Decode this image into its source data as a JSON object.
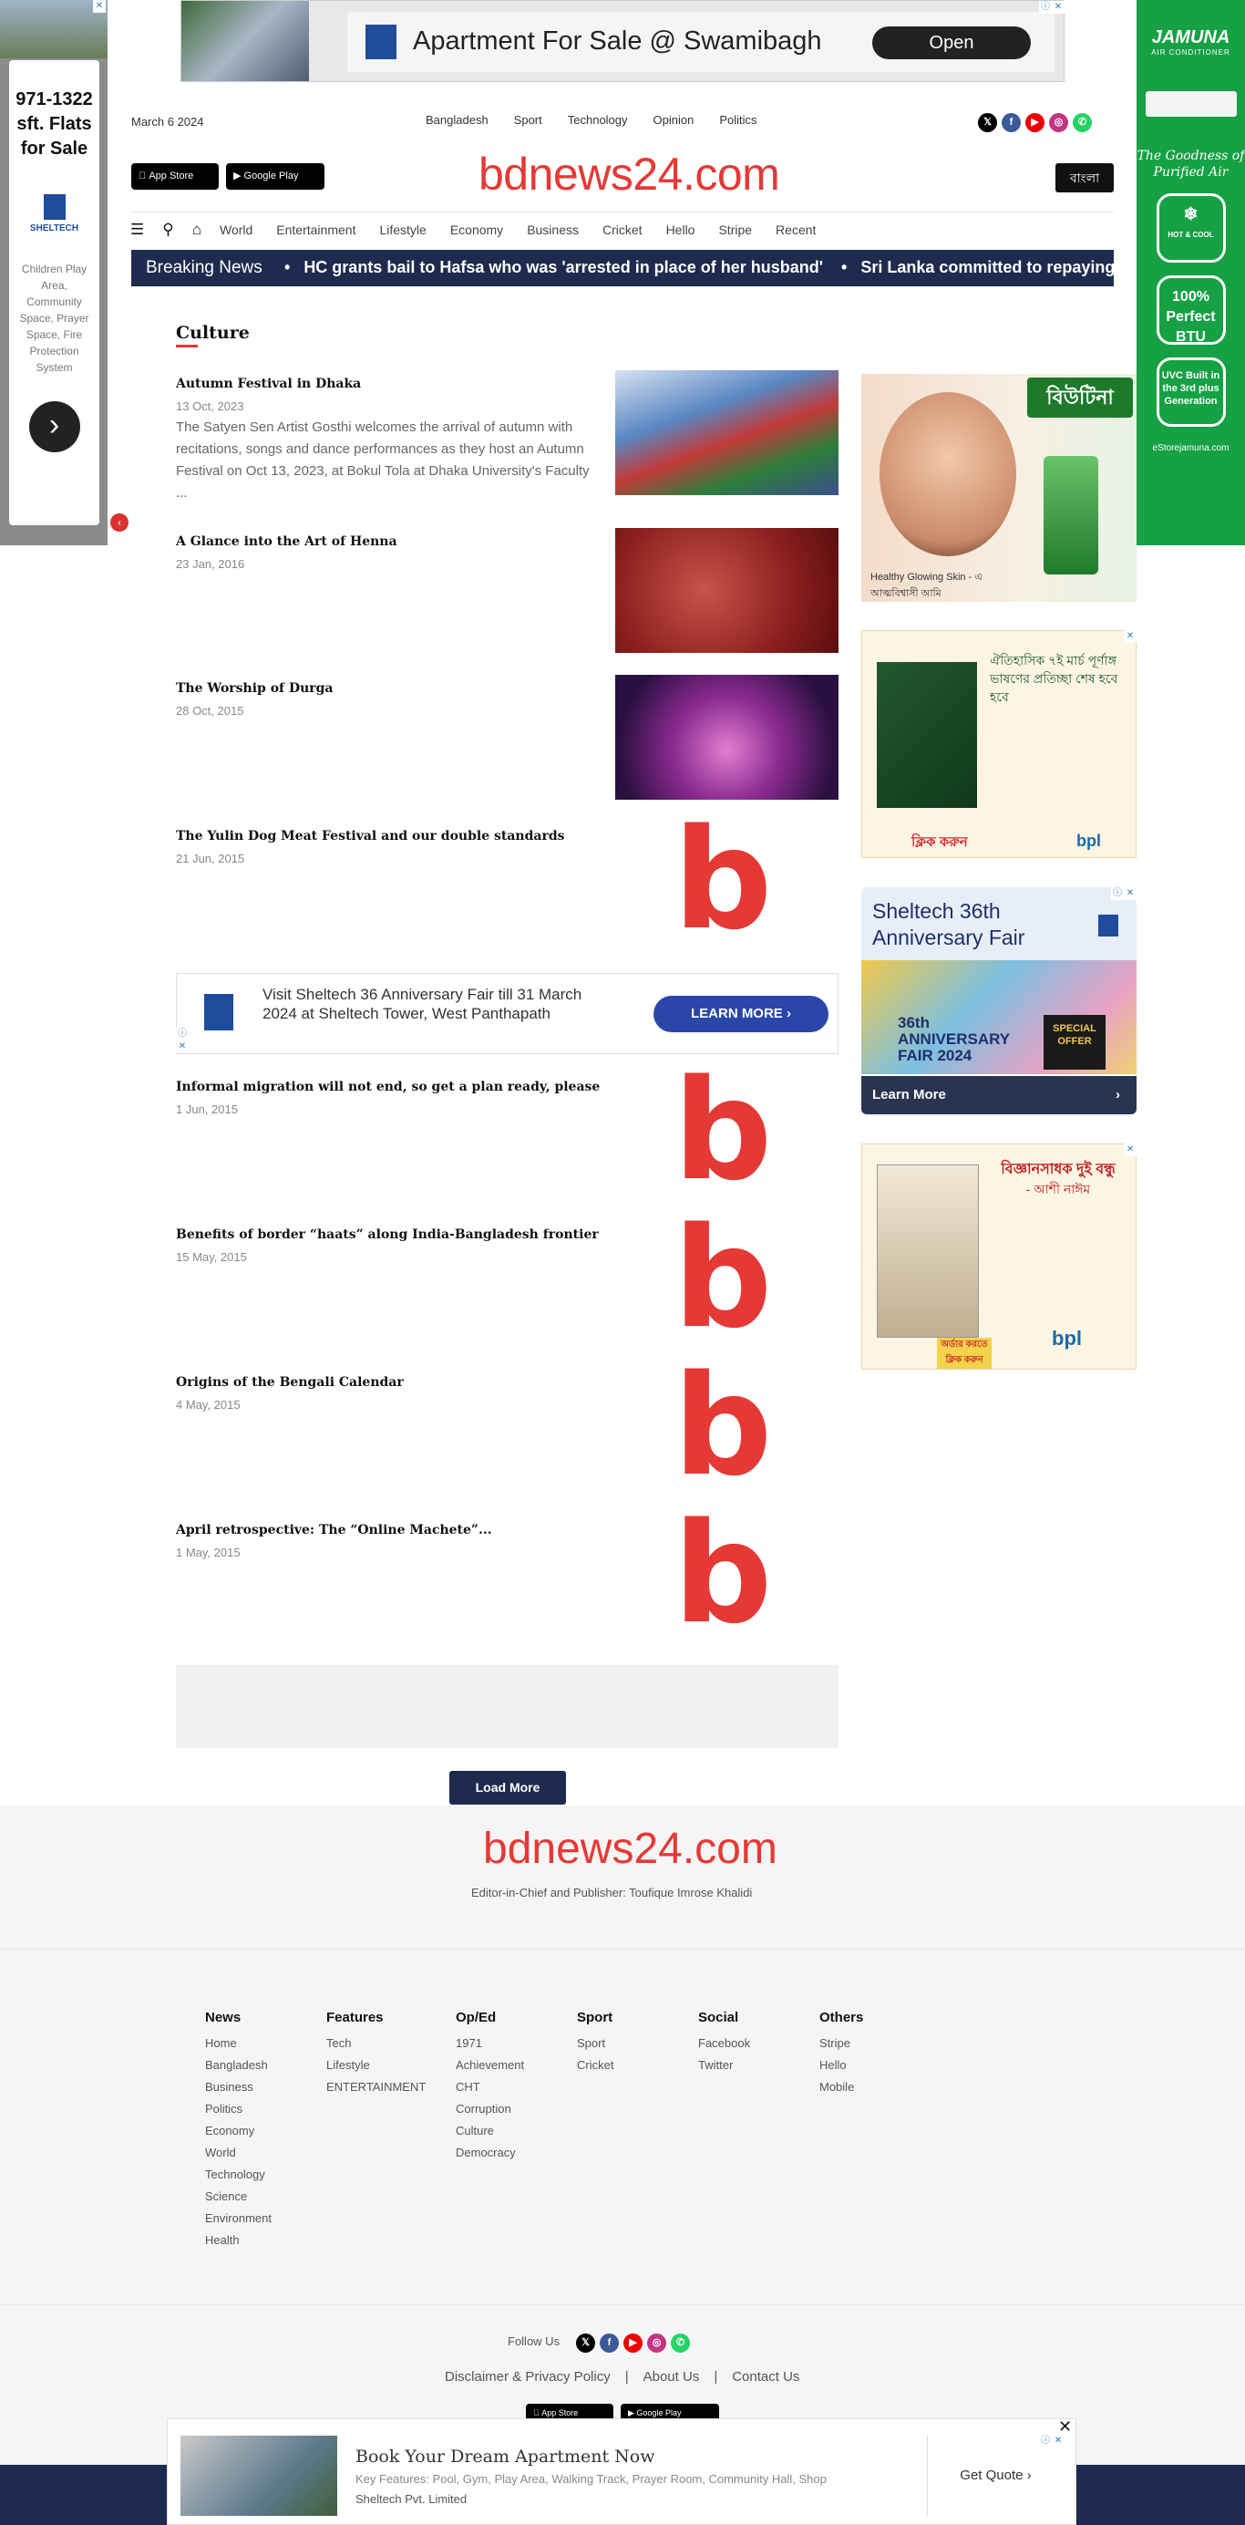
{
  "ads": {
    "left": {
      "headline": "971-1322 sft. Flats for Sale",
      "brand": "SHELTECH",
      "desc": "Children Play Area, Community Space, Prayer Space, Fire Protection System"
    },
    "right": {
      "brand": "JAMUNA",
      "sub": "AIR CONDITIONER",
      "tagline": "The Goodness of Purified Air",
      "b1": "HOT & COOL",
      "b2": "100% Perfect BTU",
      "b3": "UVC Built in the 3rd plus Generation",
      "url": "eStorejamuna.com"
    },
    "top": {
      "title": "Apartment For Sale @ Swamibagh",
      "button": "Open"
    },
    "inline": {
      "text": "Visit Sheltech 36 Anniversary Fair till 31 March 2024 at Sheltech Tower, West Panthapath",
      "button": "LEARN MORE"
    },
    "rail": [
      {
        "caption": "Healthy Glowing Skin - এ আত্মবিশ্বাসী আমি",
        "brand": "বিউটিনা"
      },
      {
        "text": "ঐতিহাসিক ৭ই মার্চ পূর্ণাঙ্গ ভাষণের প্রতিচ্ছা শেষ হবে হবে",
        "cta": "ক্লিক করুন",
        "brand": "bpl"
      },
      {
        "title": "Sheltech 36th Anniversary Fair",
        "cta": "Learn More",
        "badge": "SPECIAL OFFER",
        "fair": "36th ANNIVERSARY FAIR 2024"
      },
      {
        "title": "বিজ্ঞানসাধক দুই বন্ধু",
        "author": "- আশী নাঈম",
        "cta": "অর্ডার করতে ক্লিক করুন",
        "brand": "bpl"
      }
    ],
    "bottom": {
      "title": "Book Your Dream Apartment Now",
      "keys": "Key Features: Pool, Gym, Play Area, Walking Track, Prayer Room, Community Hall, Shop",
      "company": "Sheltech Pvt. Limited",
      "button": "Get Quote"
    }
  },
  "header": {
    "date": "March 6 2024",
    "topnav": [
      "Bangladesh",
      "Sport",
      "Technology",
      "Opinion",
      "Politics"
    ],
    "logo": "bdnews24.com",
    "lang_button": "বাংলা",
    "appstore": "App Store",
    "googleplay": "Google Play",
    "nav": [
      "World",
      "Entertainment",
      "Lifestyle",
      "Economy",
      "Business",
      "Cricket",
      "Hello",
      "Stripe",
      "Recent"
    ]
  },
  "breaking": {
    "label": "Breaking News",
    "items": [
      "HC grants bail to Hafsa who was 'arrested in place of her husband'",
      "Sri Lanka committed to repaying"
    ]
  },
  "section": {
    "title": "Culture"
  },
  "articles": [
    {
      "title": "Autumn Festival in Dhaka",
      "date": "13 Oct, 2023",
      "excerpt": "The Satyen Sen Artist Gosthi welcomes the arrival of autumn with recitations, songs and dance performances as they host an Autumn Festival on Oct 13, 2023, at Bokul Tola at Dhaka University's Faculty ..."
    },
    {
      "title": "A Glance into the Art of Henna",
      "date": "23 Jan, 2016",
      "excerpt": ""
    },
    {
      "title": "The Worship of Durga",
      "date": "28 Oct, 2015",
      "excerpt": ""
    },
    {
      "title": "The Yulin Dog Meat Festival and our double standards",
      "date": "21 Jun, 2015",
      "excerpt": ""
    },
    {
      "title": "Informal migration will not end, so get a plan ready, please",
      "date": "1 Jun, 2015",
      "excerpt": ""
    },
    {
      "title": "Benefits of border “haats” along India-Bangladesh frontier",
      "date": "15 May, 2015",
      "excerpt": ""
    },
    {
      "title": "Origins of the Bengali Calendar",
      "date": "4 May, 2015",
      "excerpt": ""
    },
    {
      "title": "April retrospective: The “Online Machete”...",
      "date": "1 May, 2015",
      "excerpt": ""
    }
  ],
  "load_more": "Load More",
  "footer": {
    "logo": "bdnews24.com",
    "editor": "Editor-in-Chief and Publisher: Toufique Imrose Khalidi",
    "columns": [
      {
        "title": "News",
        "links": [
          "Home",
          "Bangladesh",
          "Business",
          "Politics",
          "Economy",
          "World",
          "Technology",
          "Science",
          "Environment",
          "Health"
        ]
      },
      {
        "title": "Features",
        "links": [
          "Tech",
          "Lifestyle",
          "ENTERTAINMENT"
        ]
      },
      {
        "title": "Op/Ed",
        "links": [
          "1971",
          "Achievement",
          "CHT",
          "Corruption",
          "Culture",
          "Democracy"
        ]
      },
      {
        "title": "Sport",
        "links": [
          "Sport",
          "Cricket"
        ]
      },
      {
        "title": "Social",
        "links": [
          "Facebook",
          "Twitter"
        ]
      },
      {
        "title": "Others",
        "links": [
          "Stripe",
          "Hello",
          "Mobile"
        ]
      }
    ],
    "follow": "Follow Us",
    "links": [
      "Disclaimer & Privacy Policy",
      "About Us",
      "Contact Us"
    ]
  },
  "colors": {
    "brand": "#e53935",
    "navy": "#1e2b4f"
  }
}
